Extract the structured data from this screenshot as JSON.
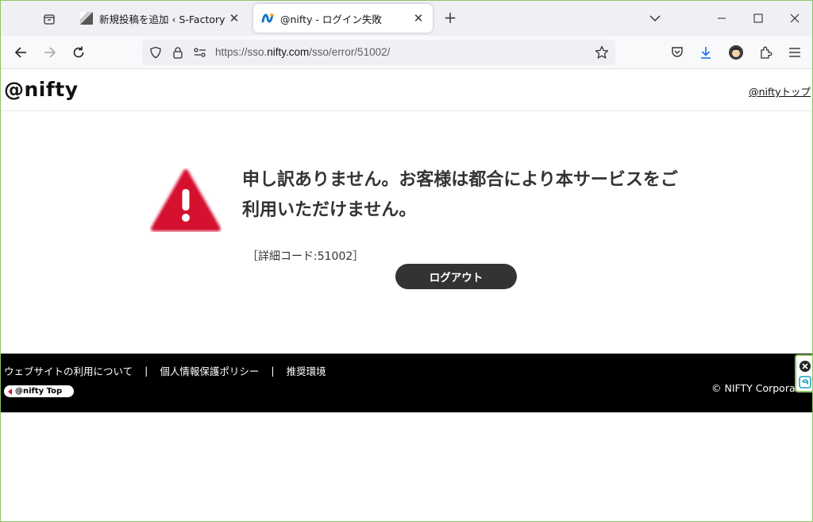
{
  "browser": {
    "tabs": [
      {
        "title": "新規投稿を追加 ‹ S-Factory — W",
        "active": false
      },
      {
        "title": "@nifty - ログイン失敗",
        "active": true
      }
    ],
    "url_prefix": "https://sso.",
    "url_domain": "nifty.com",
    "url_path": "/sso/error/51002/"
  },
  "site": {
    "logo": "@nifty",
    "top_link": "@niftyトップ"
  },
  "error": {
    "message": "申し訳ありません。お客様は都合により本サービスをご利用いただけません。",
    "detail_code": "［詳細コード:51002］",
    "logout_label": "ログアウト"
  },
  "footer": {
    "links": [
      "ウェブサイトの利用について",
      "個人情報保護ポリシー",
      "推奨環境"
    ],
    "separator": "|",
    "badge": "@nifty Top",
    "copyright": "© NIFTY Corpora"
  },
  "colors": {
    "warning": "#d4112e",
    "button": "#333333",
    "footer": "#000000",
    "window_border": "#8dc462"
  }
}
